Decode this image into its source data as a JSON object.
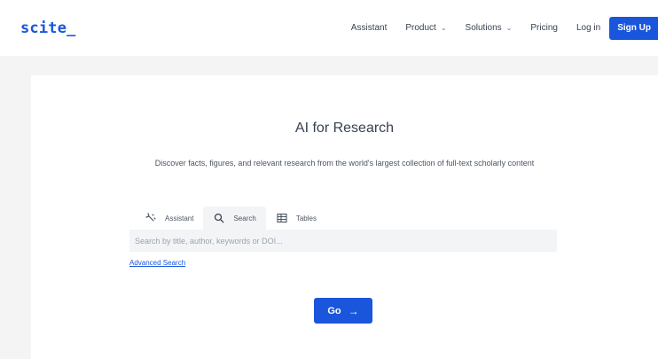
{
  "header": {
    "logo": "scite_",
    "nav": {
      "assistant": "Assistant",
      "product": "Product",
      "solutions": "Solutions",
      "pricing": "Pricing",
      "login": "Log in",
      "signup": "Sign Up"
    },
    "chevron_icon": "chevron-down-icon"
  },
  "main": {
    "title": "AI for Research",
    "subtitle": "Discover facts, figures, and relevant research from the world's largest collection of full-text scholarly content",
    "tabs": [
      {
        "label": "Assistant",
        "icon": "assistant-icon"
      },
      {
        "label": "Search",
        "icon": "search-icon"
      },
      {
        "label": "Tables",
        "icon": "table-icon"
      }
    ],
    "active_tab": "Search",
    "search": {
      "placeholder": "Search by title, author, keywords or DOI...",
      "value": ""
    },
    "advanced_search": "Advanced Search",
    "go_label": "Go",
    "go_arrow": "→"
  },
  "colors": {
    "accent": "#1a56db",
    "page_bg": "#f4f4f5",
    "card_bg": "#ffffff",
    "input_bg": "#f3f4f6"
  }
}
